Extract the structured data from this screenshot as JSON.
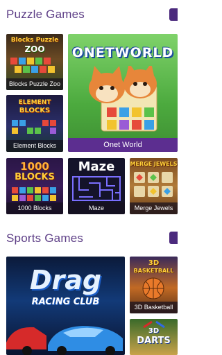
{
  "sections": {
    "puzzle": {
      "title": "Puzzle Games",
      "games": [
        {
          "caption": "Blocks Puzzle Zoo",
          "logo": "Blocks Puzzle",
          "logo2": "ZOO"
        },
        {
          "caption": "Onet World",
          "logo": "ONETWORLD"
        },
        {
          "caption": "Element Blocks",
          "logo": "ELEMENT",
          "logo2": "BLOCKS"
        },
        {
          "caption": "1000 Blocks",
          "logo": "1000",
          "logo2": "BLOCKS"
        },
        {
          "caption": "Maze",
          "logo": "Maze"
        },
        {
          "caption": "Merge Jewels",
          "logo": "MERGE JEWELS"
        }
      ]
    },
    "sports": {
      "title": "Sports Games",
      "games": [
        {
          "caption": "",
          "logo": "Drag",
          "logo2": "RACING CLUB"
        },
        {
          "caption": "3D Basketball",
          "logo": "3D",
          "logo2": "BASKETBALL"
        },
        {
          "caption": "",
          "logo": "3D",
          "logo2": "DARTS"
        }
      ]
    }
  },
  "colors": {
    "accent": "#5d3e86",
    "caption_bar": "#5c2e90"
  }
}
